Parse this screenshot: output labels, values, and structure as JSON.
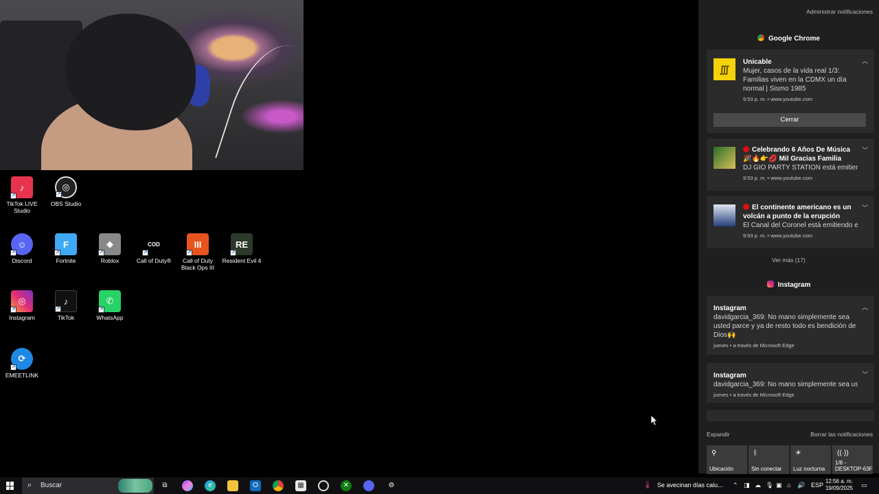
{
  "desktop_icons": [
    {
      "label": "TikTok LIVE Studio"
    },
    {
      "label": "OBS Studio"
    },
    {
      "label": "Discord"
    },
    {
      "label": "Fortnite"
    },
    {
      "label": "Roblox"
    },
    {
      "label": "Call of Duty®"
    },
    {
      "label": "Call of Duty Black Ops III"
    },
    {
      "label": "Resident Evil 4"
    },
    {
      "label": "Instagram"
    },
    {
      "label": "TikTok"
    },
    {
      "label": "WhatsApp"
    },
    {
      "label": "EMEETLINK"
    }
  ],
  "notifications": {
    "manage_label": "Administrar notificaciones",
    "groups": [
      {
        "app": "Google Chrome",
        "cards": [
          {
            "title": "Unicable",
            "text": "Mujer, casos de la vida real 1/3: Familias viven en la CDMX un día normal | Sismo 1985",
            "meta": "9:53 p. m. • www.youtube.com",
            "button": "Cerrar"
          },
          {
            "title": "Celebrando 6 Años De Música 🎉🔥👉💋 Mil Gracias Familia",
            "text": "DJ GIO PARTY STATION está emitiend",
            "meta": "9:53 p. m. • www.youtube.com"
          },
          {
            "title": "El continente americano es un volcán a punto de la erupción",
            "text": "El Canal del Coronel está emitiendo e",
            "meta": "9:53 p. m. • www.youtube.com"
          }
        ],
        "see_more": "Ver más (17)"
      },
      {
        "app": "Instagram",
        "cards": [
          {
            "title": "Instagram",
            "text": "davidgarcia_369: No mano simplemente sea usted parce y ya de resto todo es bendición de Dios🙌",
            "meta": "jueves • a través de Microsoft Edge"
          },
          {
            "title": "Instagram",
            "text": "davidgarcia_369: No mano simplemente sea us",
            "meta": "jueves • a través de Microsoft Edge"
          }
        ]
      }
    ],
    "expand_label": "Expandir",
    "clear_label": "Borrar las notificaciones",
    "quick_actions": [
      {
        "label": "Ubicación",
        "icon": "location-icon"
      },
      {
        "label": "Sin conectar",
        "icon": "bluetooth-icon"
      },
      {
        "label": "Luz nocturna",
        "icon": "sun-icon"
      },
      {
        "label": "1/8 - DESKTOP-63F",
        "icon": "project-icon"
      }
    ]
  },
  "taskbar": {
    "search_placeholder": "Buscar",
    "weather_text": "Se avecinan días calu...",
    "language": "ESP",
    "time": "12:56 a. m.",
    "date": "19/09/2025"
  }
}
